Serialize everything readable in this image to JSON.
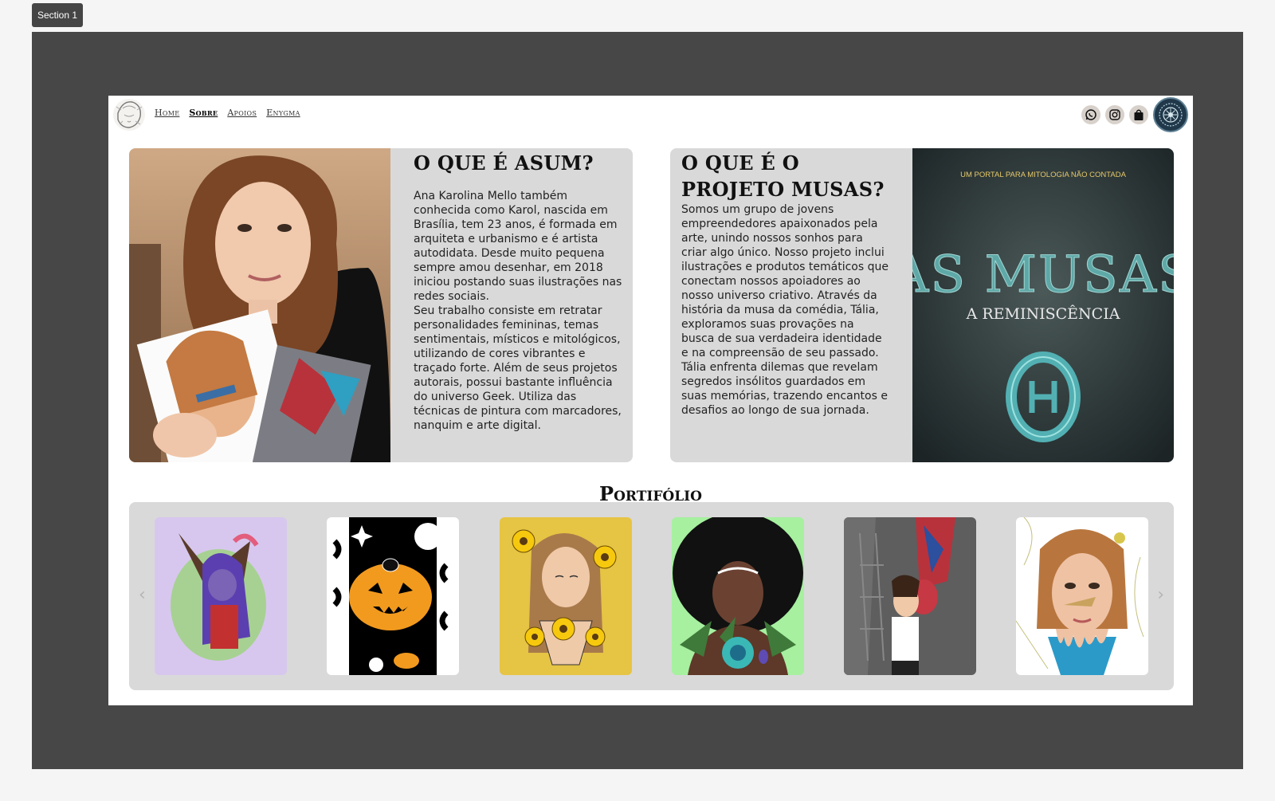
{
  "editor": {
    "section_label": "Section 1"
  },
  "nav": {
    "items": [
      {
        "label": "Home"
      },
      {
        "label": "Sobre"
      },
      {
        "label": "Apoios"
      },
      {
        "label": "Enygma"
      }
    ],
    "active": "Sobre",
    "icons": [
      "whatsapp-icon",
      "instagram-icon",
      "shopping-bag-icon",
      "emblem-badge-icon"
    ]
  },
  "about": {
    "title": "O QUE É ASUM?",
    "paragraph1": "Ana Karolina Mello também conhecida como Karol, nascida em Brasília, tem 23 anos, é formada em arquiteta e urbanismo e é artista autodidata. Desde muito pequena sempre amou desenhar, em 2018 iniciou postando suas ilustrações nas redes sociais.",
    "paragraph2": "Seu trabalho consiste em retratar personalidades femininas, temas sentimentais, místicos e mitológicos, utilizando de cores vibrantes e traçado forte. Além de seus projetos autorais, possui bastante influência do universo Geek. Utiliza das técnicas de pintura com marcadores, nanquim e arte digital."
  },
  "project": {
    "title": "O QUE É O PROJETO MUSAS?",
    "text": "Somos um grupo de jovens empreendedores apaixonados pela arte, unindo nossos sonhos para criar algo único. Nosso projeto inclui ilustrações e produtos temáticos que conectam nossos apoiadores ao nosso universo criativo. Através da história da musa da comédia, Tália, exploramos suas provações na busca de sua verdadeira identidade e na compreensão de seu passado. Tália enfrenta dilemas que revelam segredos insólitos guardados em suas memórias, trazendo encantos e desafios ao longo de sua jornada.",
    "poster": {
      "tagline": "UM PORTAL PARA MITOLOGIA NÃO CONTADA",
      "title": "AS MUSAS",
      "subtitle": "A REMINISCÊNCIA",
      "emblem": "theta-emblem-icon"
    }
  },
  "portfolio": {
    "title": "Portifólio",
    "items": [
      {
        "bg": "#d7c7ee"
      },
      {
        "bg": "#ffffff"
      },
      {
        "bg": "#e6c444"
      },
      {
        "bg": "#a6f0a0"
      },
      {
        "bg": "#5e5e5e"
      },
      {
        "bg": "#ffffff"
      }
    ],
    "prev_icon": "chevron-left-icon",
    "next_icon": "chevron-right-icon"
  }
}
